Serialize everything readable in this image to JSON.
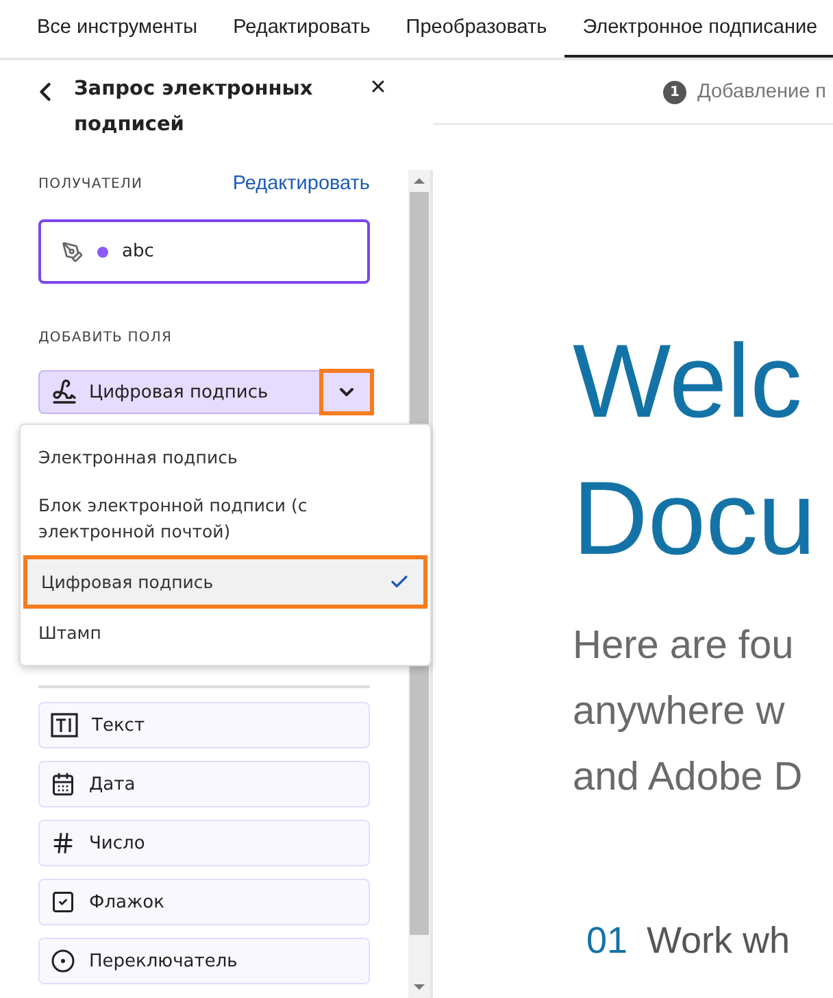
{
  "tabs": [
    {
      "label": "Все инструменты",
      "selected": false
    },
    {
      "label": "Редактировать",
      "selected": false
    },
    {
      "label": "Преобразовать",
      "selected": false
    },
    {
      "label": "Электронное подписание",
      "selected": true
    }
  ],
  "panel": {
    "title": "Запрос электронных подписей",
    "recipients_label": "ПОЛУЧАТЕЛИ",
    "edit_link": "Редактировать",
    "recipients": [
      {
        "name": "abc",
        "color": "#8a5cf5"
      }
    ],
    "add_fields_label": "ДОБАВИТЬ ПОЛЯ",
    "signature_button": {
      "label": "Цифровая подпись",
      "expanded": true
    },
    "dropdown": [
      {
        "label": "Электронная подпись",
        "selected": false
      },
      {
        "label": "Блок электронной подписи (с электронной почтой)",
        "selected": false
      },
      {
        "label": "Цифровая подпись",
        "selected": true
      },
      {
        "label": "Штамп",
        "selected": false
      }
    ],
    "fields": [
      {
        "label": "Текст",
        "kind": "text"
      },
      {
        "label": "Дата",
        "kind": "date"
      },
      {
        "label": "Число",
        "kind": "number"
      },
      {
        "label": "Флажок",
        "kind": "checkbox"
      },
      {
        "label": "Переключатель",
        "kind": "radio"
      }
    ]
  },
  "document": {
    "step_number": "1",
    "step_label": "Добавление п",
    "heading": [
      "Welc",
      "Docu"
    ],
    "intro": [
      "Here are fou",
      "anywhere w",
      "and Adobe D"
    ],
    "section_number": "01",
    "section_title": "Work wh"
  }
}
